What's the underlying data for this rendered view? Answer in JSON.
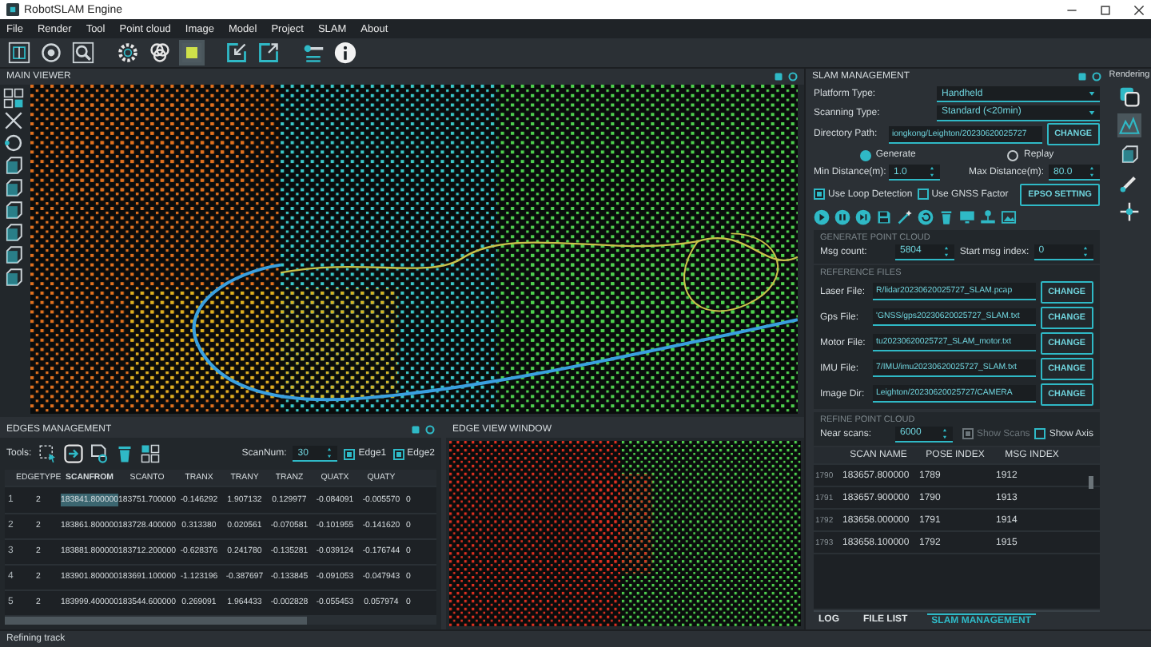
{
  "window": {
    "title": "RobotSLAM Engine"
  },
  "menu": [
    "File",
    "Render",
    "Tool",
    "Point cloud",
    "Image",
    "Model",
    "Project",
    "SLAM",
    "About"
  ],
  "main_viewer": {
    "title": "MAIN VIEWER"
  },
  "edges_management": {
    "title": "EDGES MANAGEMENT",
    "tools_label": "Tools:",
    "scan_num_label": "ScanNum:",
    "scan_num": "30",
    "edges": [
      {
        "label": "Edge1",
        "checked": true
      },
      {
        "label": "Edge2",
        "checked": true
      }
    ],
    "columns": [
      "EDGETYPE",
      "SCANFROM",
      "SCANTO",
      "TRANX",
      "TRANY",
      "TRANZ",
      "QUATX",
      "QUATY"
    ],
    "rows": [
      {
        "index": "1",
        "selected": true,
        "cells": [
          "2",
          "183841.800000",
          "183751.700000",
          "-0.146292",
          "1.907132",
          "0.129977",
          "-0.084091",
          "-0.005570",
          "0"
        ]
      },
      {
        "index": "2",
        "selected": false,
        "cells": [
          "2",
          "183861.800000",
          "183728.400000",
          "0.313380",
          "0.020561",
          "-0.070581",
          "-0.101955",
          "-0.141620",
          "0"
        ]
      },
      {
        "index": "3",
        "selected": false,
        "cells": [
          "2",
          "183881.800000",
          "183712.200000",
          "-0.628376",
          "0.241780",
          "-0.135281",
          "-0.039124",
          "-0.176744",
          "0"
        ]
      },
      {
        "index": "4",
        "selected": false,
        "cells": [
          "2",
          "183901.800000",
          "183691.100000",
          "-1.123196",
          "-0.387697",
          "-0.133845",
          "-0.091053",
          "-0.047943",
          "0"
        ]
      },
      {
        "index": "5",
        "selected": false,
        "cells": [
          "2",
          "183999.400000",
          "183544.600000",
          "0.269091",
          "1.964433",
          "-0.002828",
          "-0.055453",
          "0.057974",
          "0"
        ]
      }
    ]
  },
  "edge_view": {
    "title": "EDGE VIEW WINDOW"
  },
  "slam_management": {
    "title": "SLAM MANAGEMENT",
    "platform_type": {
      "label": "Platform Type:",
      "value": "Handheld"
    },
    "scanning_type": {
      "label": "Scanning Type:",
      "value": "Standard  (<20min)"
    },
    "directory_path": {
      "label": "Directory Path:",
      "value": "iongkong/Leighton/20230620025727",
      "button": "CHANGE"
    },
    "modes": [
      {
        "label": "Generate",
        "selected": true
      },
      {
        "label": "Replay",
        "selected": false
      }
    ],
    "min_distance": {
      "label": "Min Distance(m):",
      "value": "1.0"
    },
    "max_distance": {
      "label": "Max Distance(m):",
      "value": "80.0"
    },
    "options": [
      {
        "label": "Use Loop Detection",
        "checked": true
      },
      {
        "label": "Use GNSS Factor",
        "checked": false
      }
    ],
    "epso_button": "EPSO SETTING",
    "generate": {
      "title": "GENERATE POINT CLOUD",
      "msg_count_label": "Msg count:",
      "msg_count": "5804",
      "start_label": "Start msg index:",
      "start": "0"
    },
    "reference_files": {
      "title": "REFERENCE FILES",
      "files": [
        {
          "label": "Laser File:",
          "value": "R/lidar20230620025727_SLAM.pcap",
          "button": "CHANGE"
        },
        {
          "label": "Gps File:",
          "value": "'GNSS/gps20230620025727_SLAM.txt",
          "button": "CHANGE"
        },
        {
          "label": "Motor File:",
          "value": "tu20230620025727_SLAM_motor.txt",
          "button": "CHANGE"
        },
        {
          "label": "IMU File:",
          "value": "7/IMU/imu20230620025727_SLAM.txt",
          "button": "CHANGE"
        },
        {
          "label": "Image Dir:",
          "value": "Leighton/20230620025727/CAMERA",
          "button": "CHANGE"
        }
      ]
    },
    "refine": {
      "title": "REFINE POINT CLOUD",
      "near_label": "Near scans:",
      "near": "6000",
      "toggles": [
        {
          "label": "Show Scans",
          "checked": true,
          "disabled": true
        },
        {
          "label": "Show Axis",
          "checked": false,
          "disabled": false
        }
      ]
    },
    "table": {
      "columns": [
        "SCAN NAME",
        "POSE INDEX",
        "MSG INDEX"
      ],
      "rows": [
        {
          "index": "1790",
          "cells": [
            "183657.800000",
            "1789",
            "1912"
          ]
        },
        {
          "index": "1791",
          "cells": [
            "183657.900000",
            "1790",
            "1913"
          ]
        },
        {
          "index": "1792",
          "cells": [
            "183658.000000",
            "1791",
            "1914"
          ]
        },
        {
          "index": "1793",
          "cells": [
            "183658.100000",
            "1792",
            "1915"
          ]
        }
      ]
    }
  },
  "bottom_tabs": [
    {
      "label": "LOG",
      "selected": false
    },
    {
      "label": "FILE LIST",
      "selected": false
    },
    {
      "label": "SLAM MANAGEMENT",
      "selected": true
    }
  ],
  "rendering": {
    "title": "Rendering"
  },
  "status_bar": "Refining track"
}
